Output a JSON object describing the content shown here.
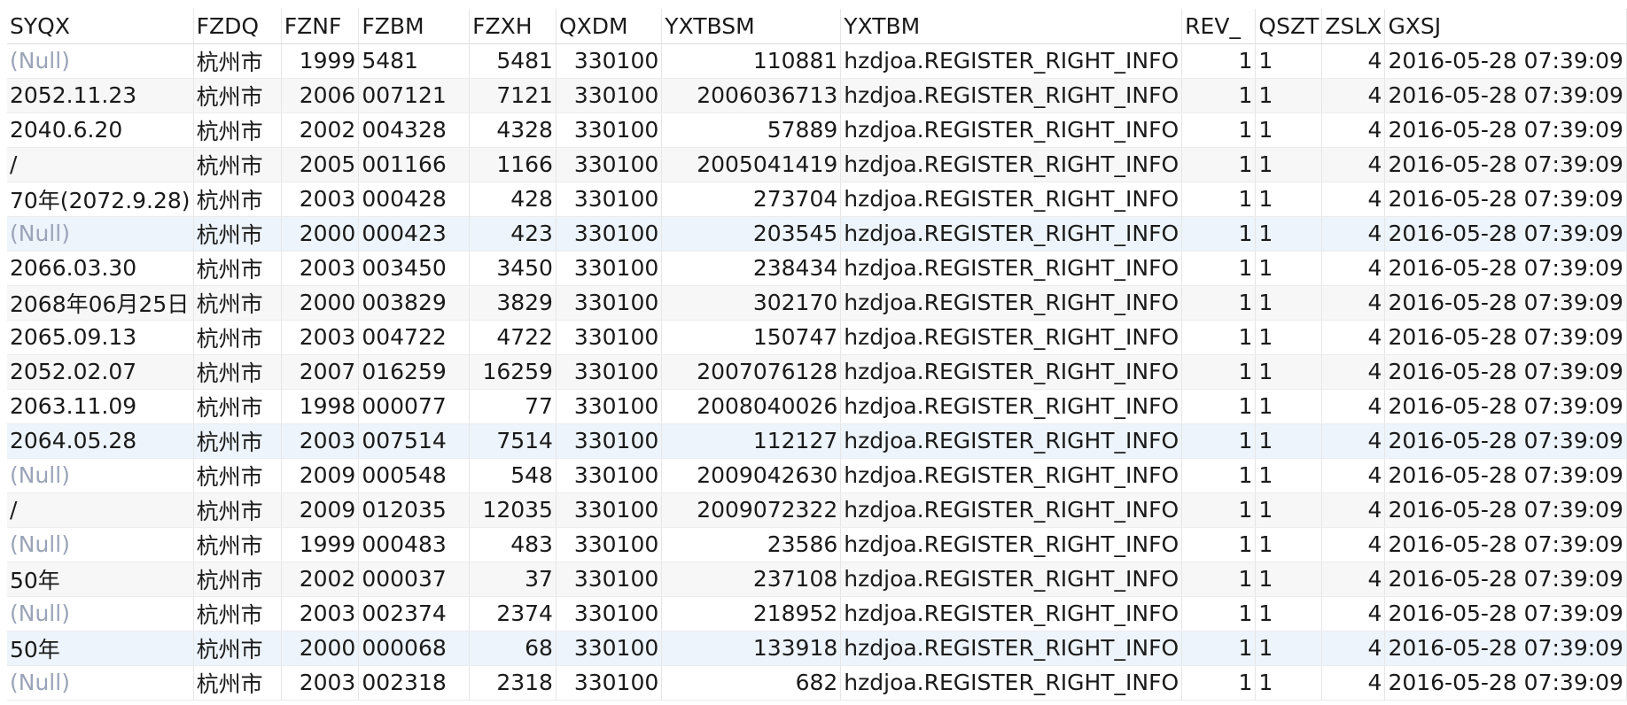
{
  "columns": [
    {
      "key": "SYQX",
      "label": "SYQX",
      "align": "left"
    },
    {
      "key": "FZDQ",
      "label": "FZDQ",
      "align": "left"
    },
    {
      "key": "FZNF",
      "label": "FZNF",
      "align": "right"
    },
    {
      "key": "FZBM",
      "label": "FZBM",
      "align": "left"
    },
    {
      "key": "FZXH",
      "label": "FZXH",
      "align": "right"
    },
    {
      "key": "QXDM",
      "label": "QXDM",
      "align": "right"
    },
    {
      "key": "YXTBSM",
      "label": "YXTBSM",
      "align": "right"
    },
    {
      "key": "YXTBM",
      "label": "YXTBM",
      "align": "left"
    },
    {
      "key": "REV_",
      "label": "REV_",
      "align": "right"
    },
    {
      "key": "QSZT",
      "label": "QSZT",
      "align": "left"
    },
    {
      "key": "ZSLX",
      "label": "ZSLX",
      "align": "right"
    },
    {
      "key": "GXSJ",
      "label": "GXSJ",
      "align": "left"
    }
  ],
  "null_label": "(Null)",
  "rows": [
    [
      "(Null)",
      "杭州市",
      "1999",
      "5481",
      "5481",
      "330100",
      "110881",
      "hzdjoa.REGISTER_RIGHT_INFO",
      "1",
      "1",
      "4",
      "2016-05-28 07:39:09"
    ],
    [
      "2052.11.23",
      "杭州市",
      "2006",
      "007121",
      "7121",
      "330100",
      "2006036713",
      "hzdjoa.REGISTER_RIGHT_INFO",
      "1",
      "1",
      "4",
      "2016-05-28 07:39:09"
    ],
    [
      "2040.6.20",
      "杭州市",
      "2002",
      "004328",
      "4328",
      "330100",
      "57889",
      "hzdjoa.REGISTER_RIGHT_INFO",
      "1",
      "1",
      "4",
      "2016-05-28 07:39:09"
    ],
    [
      "/",
      "杭州市",
      "2005",
      "001166",
      "1166",
      "330100",
      "2005041419",
      "hzdjoa.REGISTER_RIGHT_INFO",
      "1",
      "1",
      "4",
      "2016-05-28 07:39:09"
    ],
    [
      "70年(2072.9.28)",
      "杭州市",
      "2003",
      "000428",
      "428",
      "330100",
      "273704",
      "hzdjoa.REGISTER_RIGHT_INFO",
      "1",
      "1",
      "4",
      "2016-05-28 07:39:09"
    ],
    [
      "(Null)",
      "杭州市",
      "2000",
      "000423",
      "423",
      "330100",
      "203545",
      "hzdjoa.REGISTER_RIGHT_INFO",
      "1",
      "1",
      "4",
      "2016-05-28 07:39:09"
    ],
    [
      "2066.03.30",
      "杭州市",
      "2003",
      "003450",
      "3450",
      "330100",
      "238434",
      "hzdjoa.REGISTER_RIGHT_INFO",
      "1",
      "1",
      "4",
      "2016-05-28 07:39:09"
    ],
    [
      "2068年06月25日",
      "杭州市",
      "2000",
      "003829",
      "3829",
      "330100",
      "302170",
      "hzdjoa.REGISTER_RIGHT_INFO",
      "1",
      "1",
      "4",
      "2016-05-28 07:39:09"
    ],
    [
      "2065.09.13",
      "杭州市",
      "2003",
      "004722",
      "4722",
      "330100",
      "150747",
      "hzdjoa.REGISTER_RIGHT_INFO",
      "1",
      "1",
      "4",
      "2016-05-28 07:39:09"
    ],
    [
      "2052.02.07",
      "杭州市",
      "2007",
      "016259",
      "16259",
      "330100",
      "2007076128",
      "hzdjoa.REGISTER_RIGHT_INFO",
      "1",
      "1",
      "4",
      "2016-05-28 07:39:09"
    ],
    [
      "2063.11.09",
      "杭州市",
      "1998",
      "000077",
      "77",
      "330100",
      "2008040026",
      "hzdjoa.REGISTER_RIGHT_INFO",
      "1",
      "1",
      "4",
      "2016-05-28 07:39:09"
    ],
    [
      "2064.05.28",
      "杭州市",
      "2003",
      "007514",
      "7514",
      "330100",
      "112127",
      "hzdjoa.REGISTER_RIGHT_INFO",
      "1",
      "1",
      "4",
      "2016-05-28 07:39:09"
    ],
    [
      "(Null)",
      "杭州市",
      "2009",
      "000548",
      "548",
      "330100",
      "2009042630",
      "hzdjoa.REGISTER_RIGHT_INFO",
      "1",
      "1",
      "4",
      "2016-05-28 07:39:09"
    ],
    [
      "/",
      "杭州市",
      "2009",
      "012035",
      "12035",
      "330100",
      "2009072322",
      "hzdjoa.REGISTER_RIGHT_INFO",
      "1",
      "1",
      "4",
      "2016-05-28 07:39:09"
    ],
    [
      "(Null)",
      "杭州市",
      "1999",
      "000483",
      "483",
      "330100",
      "23586",
      "hzdjoa.REGISTER_RIGHT_INFO",
      "1",
      "1",
      "4",
      "2016-05-28 07:39:09"
    ],
    [
      "50年",
      "杭州市",
      "2002",
      "000037",
      "37",
      "330100",
      "237108",
      "hzdjoa.REGISTER_RIGHT_INFO",
      "1",
      "1",
      "4",
      "2016-05-28 07:39:09"
    ],
    [
      "(Null)",
      "杭州市",
      "2003",
      "002374",
      "2374",
      "330100",
      "218952",
      "hzdjoa.REGISTER_RIGHT_INFO",
      "1",
      "1",
      "4",
      "2016-05-28 07:39:09"
    ],
    [
      "50年",
      "杭州市",
      "2000",
      "000068",
      "68",
      "330100",
      "133918",
      "hzdjoa.REGISTER_RIGHT_INFO",
      "1",
      "1",
      "4",
      "2016-05-28 07:39:09"
    ],
    [
      "(Null)",
      "杭州市",
      "2003",
      "002318",
      "2318",
      "330100",
      "682",
      "hzdjoa.REGISTER_RIGHT_INFO",
      "1",
      "1",
      "4",
      "2016-05-28 07:39:09"
    ]
  ],
  "selected_rows": [
    5,
    11,
    17
  ]
}
